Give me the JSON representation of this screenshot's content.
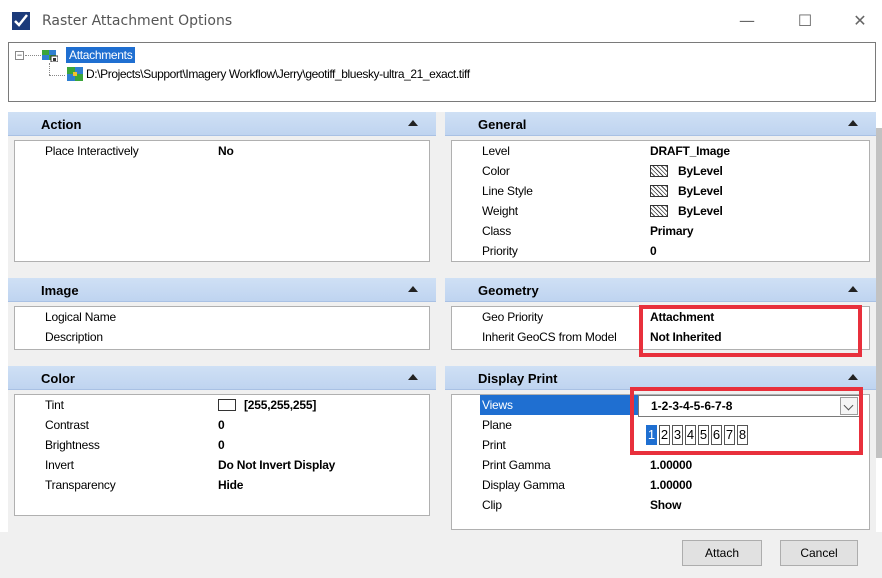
{
  "window": {
    "title": "Raster Attachment Options",
    "minimize_glyph": "—",
    "maximize_glyph": "☐",
    "close_glyph": "✕"
  },
  "tree": {
    "root_label": "Attachments",
    "child_label": "D:\\Projects\\Support\\Imagery Workflow\\Jerry\\geotiff_bluesky-ultra_21_exact.tiff",
    "toggle_glyph": "−"
  },
  "panels": {
    "action": {
      "title": "Action",
      "rows": [
        {
          "label": "Place Interactively",
          "value": "No"
        }
      ]
    },
    "general": {
      "title": "General",
      "rows": [
        {
          "label": "Level",
          "value": "DRAFT_Image"
        },
        {
          "label": "Color",
          "value": "ByLevel"
        },
        {
          "label": "Line Style",
          "value": "ByLevel"
        },
        {
          "label": "Weight",
          "value": "ByLevel"
        },
        {
          "label": "Class",
          "value": "Primary"
        },
        {
          "label": "Priority",
          "value": "0"
        }
      ]
    },
    "image": {
      "title": "Image",
      "rows": [
        {
          "label": "Logical Name",
          "value": ""
        },
        {
          "label": "Description",
          "value": ""
        }
      ]
    },
    "geometry": {
      "title": "Geometry",
      "rows": [
        {
          "label": "Geo Priority",
          "value": "Attachment"
        },
        {
          "label": "Inherit GeoCS from Model",
          "value": "Not Inherited"
        }
      ]
    },
    "color": {
      "title": "Color",
      "rows": [
        {
          "label": "Tint",
          "value": "[255,255,255]"
        },
        {
          "label": "Contrast",
          "value": "0"
        },
        {
          "label": "Brightness",
          "value": "0"
        },
        {
          "label": "Invert",
          "value": "Do Not Invert Display"
        },
        {
          "label": "Transparency",
          "value": "Hide"
        }
      ]
    },
    "display_print": {
      "title": "Display Print",
      "rows": [
        {
          "label": "Views",
          "value": "1-2-3-4-5-6-7-8"
        },
        {
          "label": "Plane",
          "value": ""
        },
        {
          "label": "Print",
          "value": ""
        },
        {
          "label": "Print Gamma",
          "value": "1.00000"
        },
        {
          "label": "Display Gamma",
          "value": "1.00000"
        },
        {
          "label": "Clip",
          "value": "Show"
        }
      ],
      "view_toggles": [
        "1",
        "2",
        "3",
        "4",
        "5",
        "6",
        "7",
        "8"
      ],
      "active_view": "1"
    }
  },
  "buttons": {
    "attach": "Attach",
    "cancel": "Cancel"
  },
  "colors": {
    "header_blue": "#cfe0f5",
    "selection_blue": "#1f6fd1",
    "highlight_red": "#e8303c"
  },
  "icons": {
    "app": "microstation-app-icon",
    "tree_root": "attachments-icon",
    "tree_child": "raster-image-icon",
    "collapse": "chevron-up-icon",
    "views_dropdown": "chevron-down-icon",
    "symbology_swatch": "hatch-swatch-icon"
  }
}
